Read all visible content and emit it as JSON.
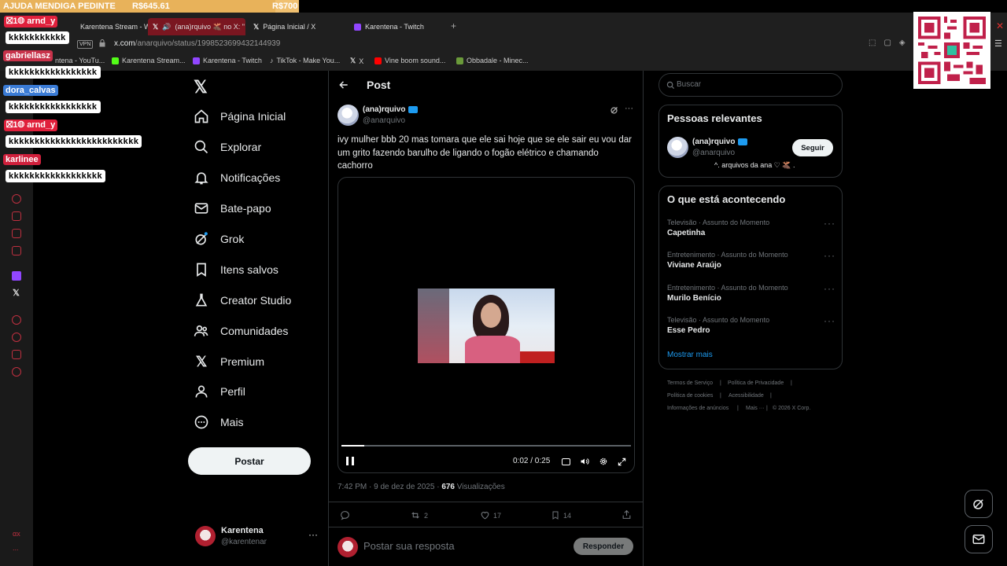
{
  "donation": {
    "title": "AJUDA MENDIGA PEDINTE",
    "current": "R$645.61",
    "goal": "R$700",
    "progress": 0.92
  },
  "browser": {
    "tabs": [
      {
        "label": "Karentena Stream - Watch"
      },
      {
        "label": "(ana)rquivo 🫎 no X: \""
      },
      {
        "label": "Página Inicial / X"
      },
      {
        "label": "Karentena - Twitch"
      }
    ],
    "vpn": "VPN",
    "url_host": "x.com",
    "url_path": "/anarquivo/status/1998523699432144939",
    "bookmarks": [
      {
        "label": "ntena - YouTu..."
      },
      {
        "label": "Karentena Stream..."
      },
      {
        "label": "Karentena - Twitch"
      },
      {
        "label": "TikTok - Make You..."
      },
      {
        "label": "X"
      },
      {
        "label": "Vine boom sound..."
      },
      {
        "label": "Obbadale - Minec..."
      }
    ],
    "sidebar_bottom": "αx",
    "sidebar_more": "..."
  },
  "chat": [
    {
      "name": "arnd_y",
      "msg": "kkkkkkkkkkk",
      "color": "#e0203c"
    },
    {
      "name": "gabriellasz",
      "msg": "kkkkkkkkkkkkkkkkk",
      "color": "#c8324a"
    },
    {
      "name": "dora_calvas",
      "msg": "kkkkkkkkkkkkkkkkk",
      "color": "#3a7bd5"
    },
    {
      "name": "arnd_y",
      "msg": "kkkkkkkkkkkkkkkkkkkkkkkkk",
      "color": "#e0203c"
    },
    {
      "name": "karlinee",
      "msg": "kkkkkkkkkkkkkkkkkk",
      "color": "#d0203c"
    }
  ],
  "nav": {
    "items": [
      {
        "label": "Página Inicial",
        "icon": "home-icon"
      },
      {
        "label": "Explorar",
        "icon": "search-icon"
      },
      {
        "label": "Notificações",
        "icon": "bell-icon"
      },
      {
        "label": "Bate-papo",
        "icon": "mail-icon"
      },
      {
        "label": "Grok",
        "icon": "grok-icon"
      },
      {
        "label": "Itens salvos",
        "icon": "bookmark-icon"
      },
      {
        "label": "Creator Studio",
        "icon": "flask-icon"
      },
      {
        "label": "Comunidades",
        "icon": "people-icon"
      },
      {
        "label": "Premium",
        "icon": "x-logo-icon"
      },
      {
        "label": "Perfil",
        "icon": "person-icon"
      },
      {
        "label": "Mais",
        "icon": "more-circle-icon"
      }
    ],
    "post_button": "Postar",
    "account": {
      "name": "Karentena",
      "handle": "@karentenar",
      "menu": "···"
    }
  },
  "post": {
    "header_title": "Post",
    "author_name": "(ana)rquivo",
    "author_handle": "@anarquivo",
    "text": "ivy mulher bbb 20 mas tomara que ele sai hoje que se ele sair eu vou dar um grito fazendo barulho de ligando o fogão elétrico e chamando cachorro",
    "video": {
      "time": "0:02 / 0:25",
      "progress": 0.08
    },
    "timestamp": "7:42 PM · 9 de dez de 2025 · ",
    "views_count": "676",
    "views_label": " Visualizações",
    "replies": "",
    "reposts": "2",
    "likes": "17",
    "bookmarks": "14",
    "reply_placeholder": "Postar sua resposta",
    "reply_button": "Responder",
    "more": "···"
  },
  "right": {
    "search_placeholder": "Buscar",
    "relevant_title": "Pessoas relevantes",
    "person": {
      "name": "(ana)rquivo",
      "handle": "@anarquivo",
      "bio": "^. arquivos da ana ♡ 🫎 .",
      "follow": "Seguir"
    },
    "trends_title": "O que está acontecendo",
    "trends": [
      {
        "meta": "Televisão · Assunto do Momento",
        "name": "Capetinha"
      },
      {
        "meta": "Entretenimento · Assunto do Momento",
        "name": "Viviane Araújo"
      },
      {
        "meta": "Entretenimento · Assunto do Momento",
        "name": "Murilo Benício"
      },
      {
        "meta": "Televisão · Assunto do Momento",
        "name": "Esse Pedro"
      }
    ],
    "show_more": "Mostrar mais",
    "footer": {
      "terms": "Termos de Serviço",
      "privacy": "Política de Privacidade",
      "cookies": "Política de cookies",
      "access": "Acessibilidade",
      "ads": "Informações de anúncios",
      "more": "Mais ···",
      "copy": "© 2026 X Corp."
    }
  },
  "colors": {
    "accent": "#1d9bf0",
    "chrome": "#1f1f1f",
    "border": "#2f3336",
    "muted": "#71767b",
    "donation": "#f0c070"
  }
}
